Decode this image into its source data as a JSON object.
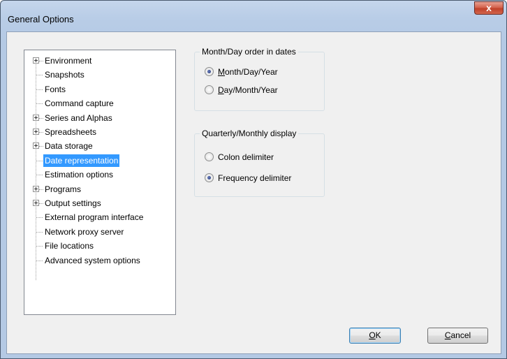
{
  "window": {
    "title": "General Options",
    "close_glyph": "x",
    "close_icon": "close-icon"
  },
  "tree": {
    "items": [
      {
        "label": "Environment",
        "expandable": true,
        "selected": false
      },
      {
        "label": "Snapshots",
        "expandable": false,
        "selected": false
      },
      {
        "label": "Fonts",
        "expandable": false,
        "selected": false
      },
      {
        "label": "Command capture",
        "expandable": false,
        "selected": false
      },
      {
        "label": "Series and Alphas",
        "expandable": true,
        "selected": false
      },
      {
        "label": "Spreadsheets",
        "expandable": true,
        "selected": false
      },
      {
        "label": "Data storage",
        "expandable": true,
        "selected": false
      },
      {
        "label": "Date representation",
        "expandable": false,
        "selected": true
      },
      {
        "label": "Estimation options",
        "expandable": false,
        "selected": false
      },
      {
        "label": "Programs",
        "expandable": true,
        "selected": false
      },
      {
        "label": "Output settings",
        "expandable": true,
        "selected": false
      },
      {
        "label": "External program interface",
        "expandable": false,
        "selected": false
      },
      {
        "label": "Network proxy server",
        "expandable": false,
        "selected": false
      },
      {
        "label": "File locations",
        "expandable": false,
        "selected": false
      },
      {
        "label": "Advanced system options",
        "expandable": false,
        "selected": false
      }
    ]
  },
  "date_order": {
    "title": "Month/Day order in dates",
    "options": [
      {
        "mnemonic": "M",
        "rest": "onth/Day/Year",
        "checked": true
      },
      {
        "mnemonic": "D",
        "rest": "ay/Month/Year",
        "checked": false
      }
    ]
  },
  "quarterly": {
    "title": "Quarterly/Monthly display",
    "options": [
      {
        "label": "Colon delimiter",
        "checked": false
      },
      {
        "label": "Frequency delimiter",
        "checked": true
      }
    ]
  },
  "buttons": {
    "ok": {
      "mnemonic": "O",
      "rest": "K"
    },
    "cancel": {
      "mnemonic": "C",
      "rest": "ancel"
    }
  }
}
